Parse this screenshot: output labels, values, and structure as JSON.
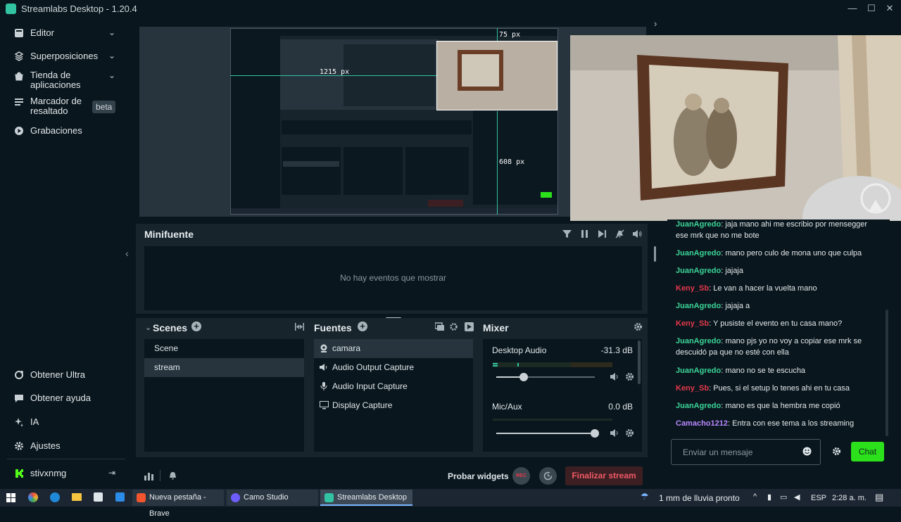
{
  "window": {
    "title": "Streamlabs Desktop - 1.20.4"
  },
  "sidebar": {
    "items": [
      {
        "label": "Editor",
        "icon": "editor-icon"
      },
      {
        "label": "Superposiciones",
        "icon": "overlays-icon"
      },
      {
        "label": "Tienda de aplicaciones",
        "icon": "app-store-icon"
      },
      {
        "label": "Marcador de resaltado",
        "icon": "highlighter-icon",
        "badge": "beta"
      },
      {
        "label": "Grabaciones",
        "icon": "recordings-icon"
      }
    ],
    "bottom": [
      {
        "label": "Obtener Ultra",
        "icon": "ultra-icon"
      },
      {
        "label": "Obtener ayuda",
        "icon": "help-icon"
      },
      {
        "label": "IA",
        "icon": "ai-icon"
      },
      {
        "label": "Ajustes",
        "icon": "settings-icon"
      }
    ],
    "user": {
      "name": "stivxnmg"
    }
  },
  "preview": {
    "measure_top": "75 px",
    "measure_left": "1215 px",
    "measure_bottom": "608 px"
  },
  "minifeed": {
    "title": "Minifuente",
    "empty": "No hay eventos que mostrar"
  },
  "scenes": {
    "title": "Scenes",
    "items": [
      "Scene",
      "stream"
    ],
    "selected": "stream"
  },
  "sources": {
    "title": "Fuentes",
    "items": [
      {
        "label": "camara",
        "icon": "webcam-icon"
      },
      {
        "label": "Audio Output Capture",
        "icon": "speaker-icon"
      },
      {
        "label": "Audio Input Capture",
        "icon": "microphone-icon"
      },
      {
        "label": "Display Capture",
        "icon": "monitor-icon"
      }
    ]
  },
  "mixer": {
    "title": "Mixer",
    "channels": [
      {
        "name": "Desktop Audio",
        "db": "-31.3 dB",
        "level": 0.28
      },
      {
        "name": "Mic/Aux",
        "db": "0.0 dB",
        "level": 1.0
      }
    ]
  },
  "footer": {
    "test_widgets": "Probar widgets",
    "rec": "REC",
    "end_stream": "Finalizar stream"
  },
  "chat": {
    "messages": [
      {
        "user": "JuanAgredo",
        "color": "#3dd598",
        "text": "jaja mano ahi me escribio por mensegger ese mrk que no me bote"
      },
      {
        "user": "JuanAgredo",
        "color": "#3dd598",
        "text": "mano pero culo de mona uno que culpa"
      },
      {
        "user": "JuanAgredo",
        "color": "#3dd598",
        "text": "jajaja"
      },
      {
        "user": "Keny_Sb",
        "color": "#e5384c",
        "text": "Le van a hacer la vuelta mano"
      },
      {
        "user": "JuanAgredo",
        "color": "#3dd598",
        "text": "jajaja a"
      },
      {
        "user": "Keny_Sb",
        "color": "#e5384c",
        "text": "Y pusiste el evento en tu casa mano?"
      },
      {
        "user": "JuanAgredo",
        "color": "#3dd598",
        "text": "mano pjs yo no voy a copiar ese mrk se descuidó pa que no esté con ella"
      },
      {
        "user": "JuanAgredo",
        "color": "#3dd598",
        "text": "mano no se te escucha"
      },
      {
        "user": "Keny_Sb",
        "color": "#e5384c",
        "text": "Pues, si el setup lo tenes ahi en tu casa"
      },
      {
        "user": "JuanAgredo",
        "color": "#3dd598",
        "text": "mano es que la hembra me copió"
      },
      {
        "user": "Camacho1212",
        "color": "#b988ff",
        "text": "Entra con ese tema a los streaming"
      }
    ],
    "placeholder": "Enviar un mensaje",
    "send": "Chat"
  },
  "taskbar": {
    "apps": [
      {
        "label": "Nueva pestaña - Brave",
        "color": "#f2542d"
      },
      {
        "label": "Camo Studio",
        "color": "#6d5dfc"
      },
      {
        "label": "Streamlabs Desktop",
        "color": "#31c3a2"
      }
    ],
    "weather": "1 mm de lluvia pronto",
    "lang": "ESP",
    "time": "2:28 a. m."
  }
}
